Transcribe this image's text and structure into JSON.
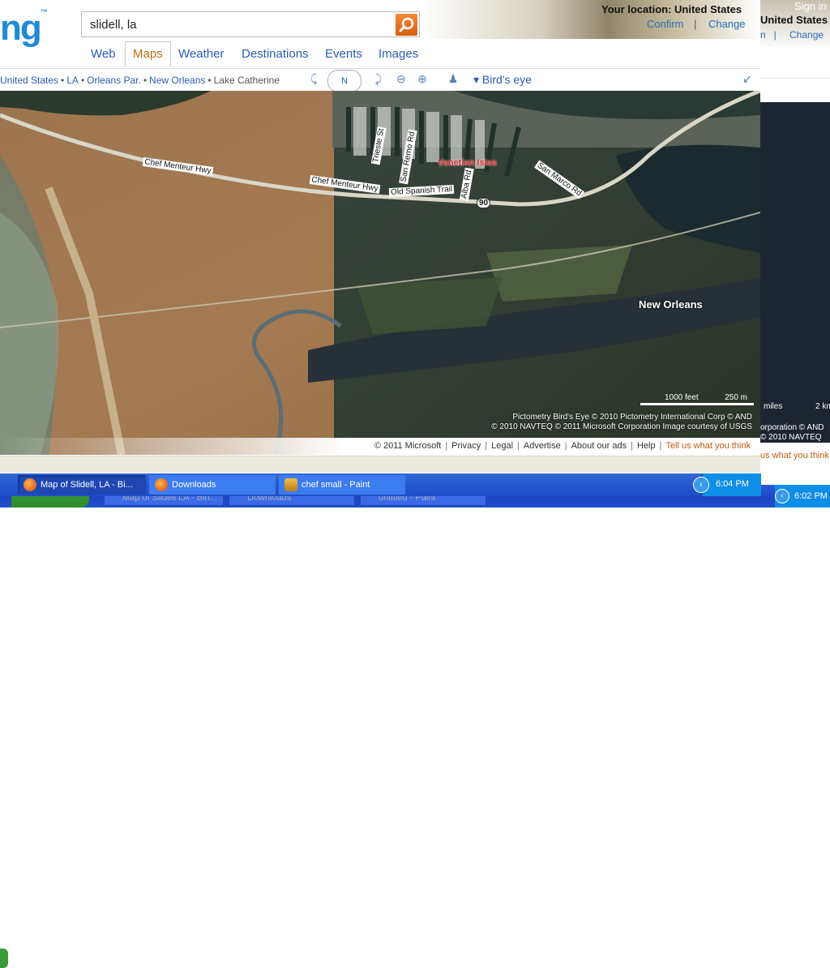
{
  "search": {
    "query": "slidell, la"
  },
  "location": {
    "label": "Your location: United States",
    "confirm": "Confirm",
    "change": "Change",
    "separator": "|"
  },
  "nav": {
    "items": [
      "Web",
      "Maps",
      "Weather",
      "Destinations",
      "Events",
      "Images"
    ],
    "active": "Maps"
  },
  "breadcrumbs": [
    "United States",
    "LA",
    "Orleans Par.",
    "New Orleans",
    "Lake Catherine"
  ],
  "toolbar": {
    "compass": "N",
    "view_label": "Bird's eye"
  },
  "map": {
    "road_labels": [
      "Chef Menteur Hwy",
      "Chef Menteur Hwy",
      "Old Spanish Trail",
      "Trieste St",
      "San Remo Rd",
      "Alba Rd",
      "San Marco Rd",
      "90"
    ],
    "place_labels": [
      "Venetian Isles",
      "New Orleans"
    ],
    "scale": {
      "feet": "1000 feet",
      "meters": "250 m"
    },
    "attribution": [
      "Pictometry Bird's Eye © 2010 Pictometry International Corp  © AND",
      "© 2010 NAVTEQ  © 2011 Microsoft Corporation  Image courtesy of USGS"
    ]
  },
  "footer": {
    "copyright": "© 2011 Microsoft",
    "links": [
      "Privacy",
      "Legal",
      "Advertise",
      "About our ads",
      "Help"
    ],
    "feedback": "Tell us what you think"
  },
  "taskbar": {
    "tasks": [
      "Map of Slidell, LA - Bi...",
      "Downloads",
      "chef small - Paint"
    ],
    "clock": "6:04 PM"
  },
  "background_screenshot": {
    "sign_in": "Sign in",
    "location": "United States",
    "change": "Change",
    "tasks": [
      "Map of Slidell LA - Bin...",
      "Downloads",
      "untitled - Paint"
    ],
    "clock": "6:02 PM",
    "footer_feedback": "us what you think",
    "scale": "2 km",
    "miles": "miles",
    "attr1": "orporation  © AND",
    "attr2": "© 2010 NAVTEQ"
  },
  "colors": {
    "link": "#2a5ab8",
    "active_tab": "#c06a12",
    "search_button": "#e8701a",
    "taskbar": "#2458d0"
  }
}
